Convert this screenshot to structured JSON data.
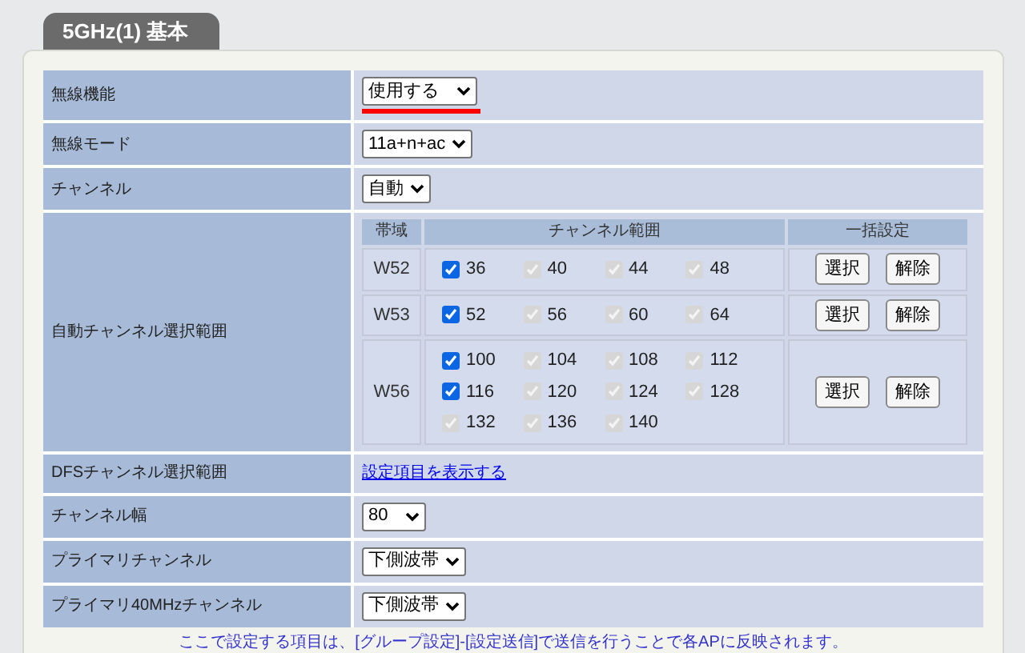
{
  "tab": {
    "title": "5GHz(1) 基本"
  },
  "rows": [
    {
      "kind": "select",
      "label": "無線機能",
      "value": "使用する",
      "highlighted": true
    },
    {
      "kind": "select",
      "label": "無線モード",
      "value": "11a+n+ac",
      "highlighted": false
    },
    {
      "kind": "select",
      "label": "チャンネル",
      "value": "自動",
      "highlighted": false
    },
    {
      "kind": "channels",
      "label": "自動チャンネル選択範囲"
    },
    {
      "kind": "link",
      "label": "DFSチャンネル選択範囲",
      "value": "設定項目を表示する"
    },
    {
      "kind": "select",
      "label": "チャンネル幅",
      "value": "80",
      "highlighted": false
    },
    {
      "kind": "select",
      "label": "プライマリチャンネル",
      "value": "下側波帯",
      "highlighted": false
    },
    {
      "kind": "select",
      "label": "プライマリ40MHzチャンネル",
      "value": "下側波帯",
      "highlighted": false
    }
  ],
  "channel_table": {
    "columns": [
      "帯域",
      "チャンネル範囲",
      "一括設定"
    ],
    "bands": [
      {
        "name": "W52",
        "buttons": [
          "選択",
          "解除"
        ],
        "channels": [
          {
            "label": "36",
            "checked": true,
            "disabled": false
          },
          {
            "label": "40",
            "checked": true,
            "disabled": true
          },
          {
            "label": "44",
            "checked": true,
            "disabled": true
          },
          {
            "label": "48",
            "checked": true,
            "disabled": true
          }
        ]
      },
      {
        "name": "W53",
        "buttons": [
          "選択",
          "解除"
        ],
        "channels": [
          {
            "label": "52",
            "checked": true,
            "disabled": false
          },
          {
            "label": "56",
            "checked": true,
            "disabled": true
          },
          {
            "label": "60",
            "checked": true,
            "disabled": true
          },
          {
            "label": "64",
            "checked": true,
            "disabled": true
          }
        ]
      },
      {
        "name": "W56",
        "buttons": [
          "選択",
          "解除"
        ],
        "channels": [
          {
            "label": "100",
            "checked": true,
            "disabled": false
          },
          {
            "label": "104",
            "checked": true,
            "disabled": true
          },
          {
            "label": "108",
            "checked": true,
            "disabled": true
          },
          {
            "label": "112",
            "checked": true,
            "disabled": true
          },
          {
            "label": "116",
            "checked": true,
            "disabled": false
          },
          {
            "label": "120",
            "checked": true,
            "disabled": true
          },
          {
            "label": "124",
            "checked": true,
            "disabled": true
          },
          {
            "label": "128",
            "checked": true,
            "disabled": true
          },
          {
            "label": "132",
            "checked": true,
            "disabled": true
          },
          {
            "label": "136",
            "checked": true,
            "disabled": true
          },
          {
            "label": "140",
            "checked": true,
            "disabled": true
          }
        ]
      }
    ]
  },
  "footer_note": "ここで設定する項目は、[グループ設定]-[設定送信]で送信を行うことで各APに反映されます。"
}
